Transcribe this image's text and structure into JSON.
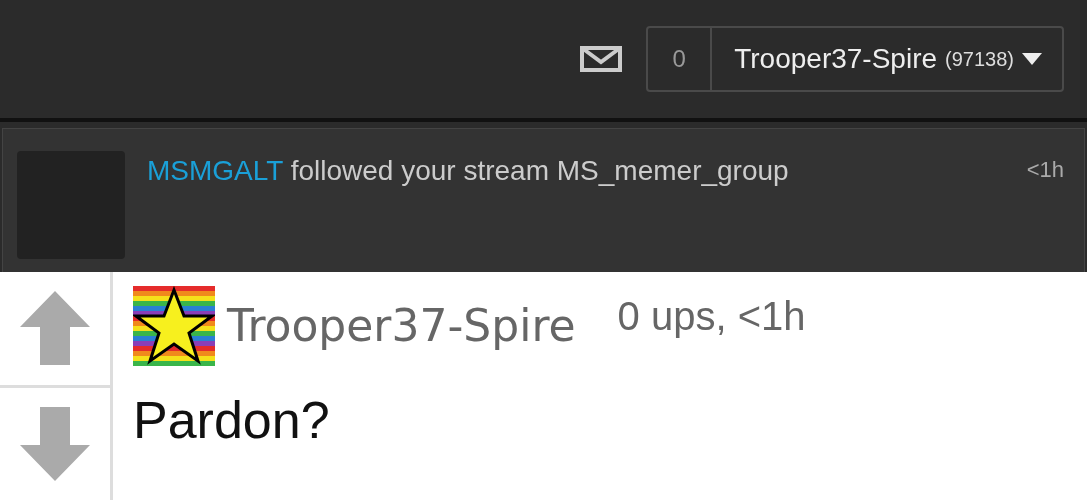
{
  "header": {
    "mail_count": "0",
    "username": "Trooper37-Spire",
    "points": "(97138)"
  },
  "notifications": [
    {
      "user": "MSMGALT",
      "text": "followed your stream MS_memer_group",
      "time": "<1h"
    }
  ],
  "comment": {
    "username": "Trooper37-Spire",
    "meta": "0 ups, <1h",
    "text": "Pardon?"
  }
}
